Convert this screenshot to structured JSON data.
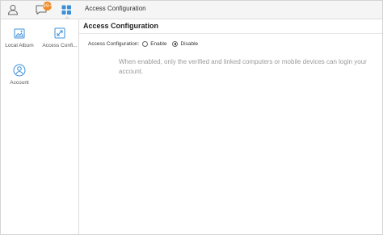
{
  "topbar": {
    "icons": [
      {
        "name": "user-icon"
      },
      {
        "name": "chat-icon",
        "badge": "99+"
      },
      {
        "name": "grid-icon",
        "active": true
      }
    ],
    "window_title": "Access Configuration"
  },
  "sidebar": {
    "items": [
      {
        "label": "Local Album",
        "icon": "picture-icon"
      },
      {
        "label": "Access Confi...",
        "icon": "access-config-icon"
      },
      {
        "label": "Account",
        "icon": "account-icon"
      }
    ]
  },
  "main": {
    "title": "Access Configuration",
    "setting_label": "Access Configuration:",
    "options": [
      {
        "label": "Enable",
        "selected": false
      },
      {
        "label": "Disable",
        "selected": true
      }
    ],
    "help_text": "When enabled, only the verified and linked computers or mobile devices can login your account."
  },
  "colors": {
    "accent_blue": "#3a8fd8",
    "badge_orange": "#f08a24",
    "help_text_gray": "#9a9a9a"
  }
}
